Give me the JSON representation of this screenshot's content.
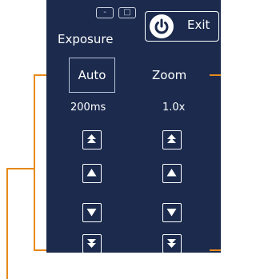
{
  "window": {
    "minimize_glyph": "-",
    "restore_glyph": "□"
  },
  "exit_button": {
    "label": "Exit",
    "icon": "power-icon"
  },
  "exposure": {
    "title": "Exposure",
    "auto_label": "Auto",
    "value": "200ms"
  },
  "zoom": {
    "title": "Zoom",
    "value": "1.0x"
  },
  "colors": {
    "panel": "#1b2a4d",
    "callout": "#e8891a",
    "text": "#ffffff"
  }
}
